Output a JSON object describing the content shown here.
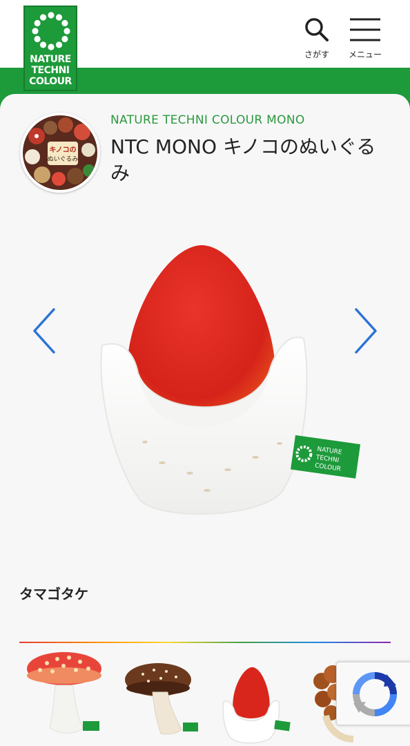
{
  "header": {
    "logo_lines": [
      "NATURE",
      "TECHNI",
      "COLOUR"
    ],
    "search_label": "さがす",
    "menu_label": "メニュー"
  },
  "product": {
    "brand": "NATURE TECHNI COLOUR MONO",
    "title": "NTC MONO キノコのぬいぐるみ",
    "name": "タマゴタケ"
  },
  "thumbnails": [
    {
      "icon": "fly-agaric-plush-thumbnail"
    },
    {
      "icon": "shiitake-plush-thumbnail"
    },
    {
      "icon": "tamagotake-plush-thumbnail"
    },
    {
      "icon": "nameko-plush-thumbnail"
    }
  ],
  "colors": {
    "brand_green": "#1d9a3a",
    "accent_blue": "#2d73d6",
    "mushroom_red": "#d9261c"
  }
}
